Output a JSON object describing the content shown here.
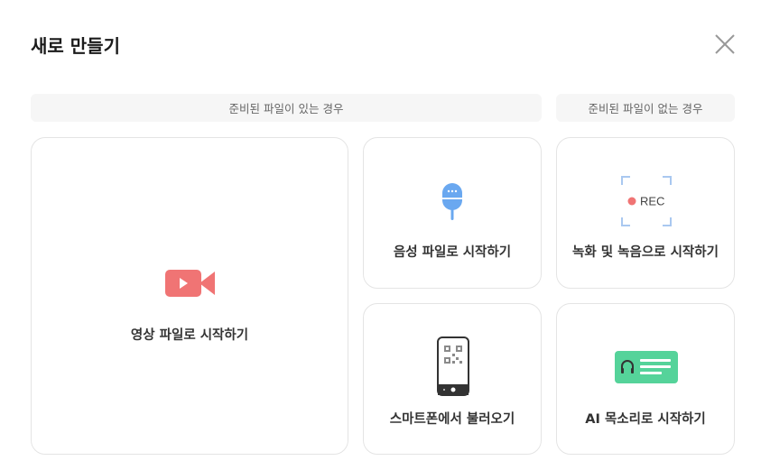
{
  "dialog": {
    "title": "새로 만들기"
  },
  "sections": {
    "with_file": "준비된 파일이 있는 경우",
    "without_file": "준비된 파일이 없는 경우"
  },
  "options": {
    "video": "영상 파일로 시작하기",
    "audio": "음성 파일로 시작하기",
    "smartphone": "스마트폰에서 불러오기",
    "record": "녹화 및 녹음으로 시작하기",
    "ai_voice": "AI 목소리로 시작하기"
  },
  "rec_badge": "REC",
  "colors": {
    "video_icon": "#f07474",
    "mic_icon": "#6aa8f0",
    "rec_dot": "#f07474",
    "rec_frame": "#a9c8f0",
    "ai_card": "#55d39a"
  }
}
